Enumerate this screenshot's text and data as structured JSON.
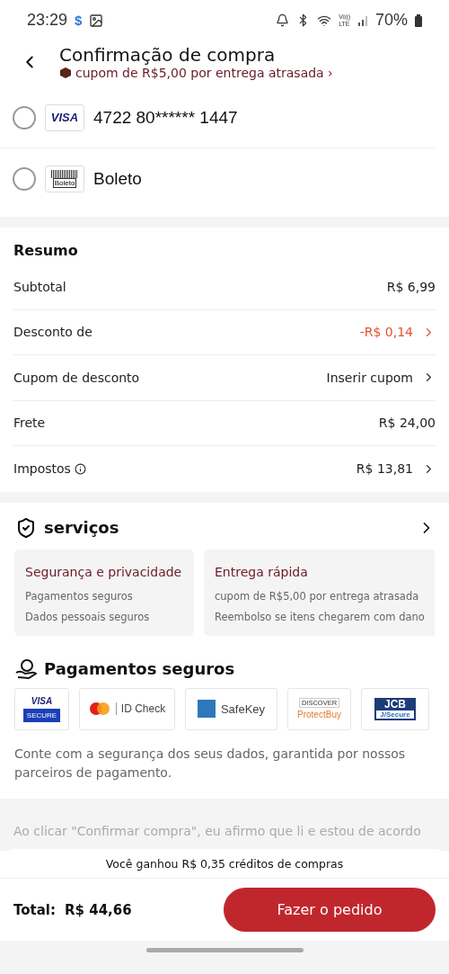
{
  "status_bar": {
    "time": "23:29",
    "dollar": "$",
    "volte_top": "Vo))",
    "volte_bottom": "LTE",
    "battery": "70%"
  },
  "header": {
    "title": "Confirmação de compra",
    "promo": "cupom de R$5,00 por entrega atrasada ›"
  },
  "payment_methods": [
    {
      "kind": "visa",
      "logo": "VISA",
      "label": "4722 80****** 1447",
      "selected": false
    },
    {
      "kind": "boleto",
      "logo": "Boleto",
      "label": "Boleto",
      "selected": false
    }
  ],
  "summary": {
    "title": "Resumo",
    "rows": [
      {
        "label": "Subtotal",
        "value": "R$ 6,99",
        "kind": "plain",
        "info": false,
        "chevron": false
      },
      {
        "label": "Desconto de",
        "value": "-R$ 0,14",
        "kind": "discount",
        "info": false,
        "chevron": true
      },
      {
        "label": "Cupom de desconto",
        "value": "Inserir cupom",
        "kind": "plain",
        "info": false,
        "chevron": true
      },
      {
        "label": "Frete",
        "value": "R$ 24,00",
        "kind": "plain",
        "info": false,
        "chevron": false
      },
      {
        "label": "Impostos",
        "value": "R$ 13,81",
        "kind": "plain",
        "info": true,
        "chevron": true
      }
    ]
  },
  "services": {
    "title": "serviços",
    "cards": [
      {
        "title": "Segurança e privacidade",
        "lines": [
          "Pagamentos seguros",
          "Dados pessoais seguros"
        ]
      },
      {
        "title": "Entrega rápida",
        "lines": [
          "cupom de R$5,00 por entrega atrasada",
          "Reembolso se itens chegarem com dano"
        ]
      }
    ]
  },
  "secure_payments": {
    "title": "Pagamentos seguros",
    "badges": [
      {
        "kind": "visa",
        "texts": [
          "VISA",
          "SECURE"
        ]
      },
      {
        "kind": "mastercard",
        "texts": [
          "ID Check"
        ]
      },
      {
        "kind": "amex",
        "texts": [
          "SafeKey"
        ]
      },
      {
        "kind": "discover",
        "texts": [
          "DISCOVER",
          "ProtectBuy"
        ]
      },
      {
        "kind": "jcb",
        "texts": [
          "JCB",
          "J/Secure"
        ]
      }
    ],
    "note": "Conte com a segurança dos seus dados, garantida por nossos parceiros de pagamento."
  },
  "terms": "Ao clicar \"Confirmar compra\", eu afirmo que li e estou de acordo",
  "footer": {
    "credits": "Você ganhou R$ 0,35 créditos de compras",
    "total_label": "Total:",
    "total_value": "R$ 44,66",
    "button": "Fazer o pedido"
  }
}
